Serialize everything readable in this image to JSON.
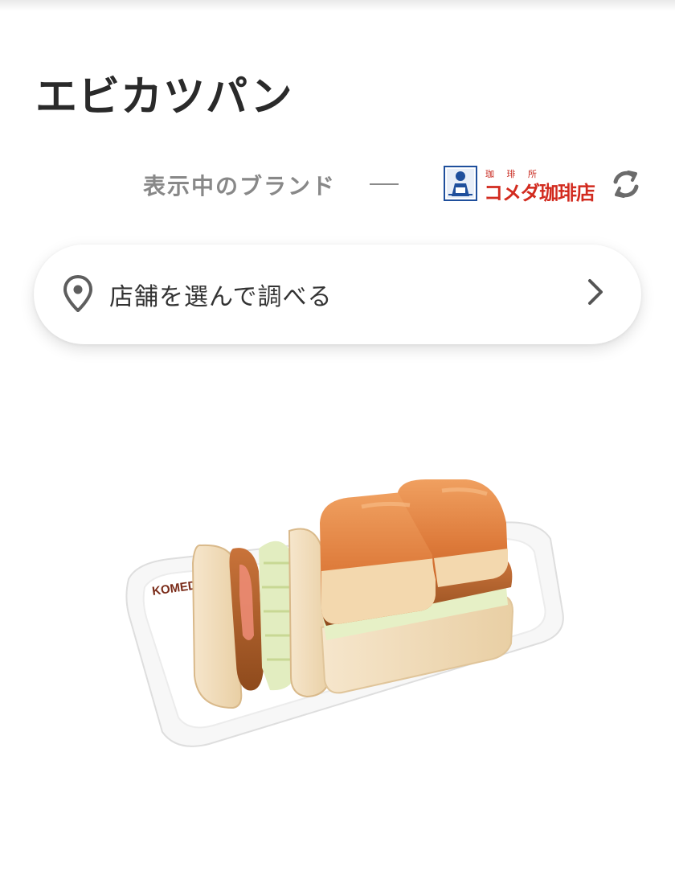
{
  "page": {
    "title": "エビカツパン"
  },
  "brand": {
    "label": "表示中のブランド",
    "separator": "—",
    "logo_small_text": "珈 琲 所",
    "logo_main_text": "コメダ珈琲店",
    "logo_color": "#d22b1f",
    "logo_icon": "komeda-logo-icon",
    "refresh_icon": "refresh-icon"
  },
  "store_search": {
    "label": "店舗を選んで調べる",
    "pin_icon": "location-pin-icon",
    "chevron_icon": "chevron-right-icon"
  },
  "product_image": {
    "plate_text": "KOMEDA"
  }
}
